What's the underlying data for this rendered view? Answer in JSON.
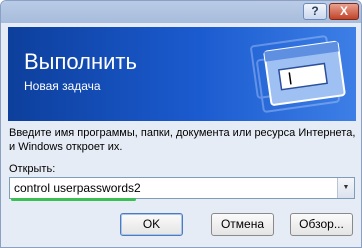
{
  "window": {
    "help_button": "?",
    "close_button": "X",
    "title": "Выполнить",
    "subtitle": "Новая задача",
    "description": "Введите имя программы, папки, документа или ресурса Интернета, и Windows откроет их.",
    "open_label": "Открыть:",
    "input_value": "control userpasswords2",
    "ok_label": "OK",
    "cancel_label": "Отмена",
    "browse_label": "Обзор...",
    "icons": {
      "banner_art": "run-dialog-icon",
      "dropdown": "chevron-down-icon"
    },
    "colors": {
      "banner": "#1b5bd0",
      "underline": "#3bbf55",
      "close": "#c2432a"
    }
  }
}
